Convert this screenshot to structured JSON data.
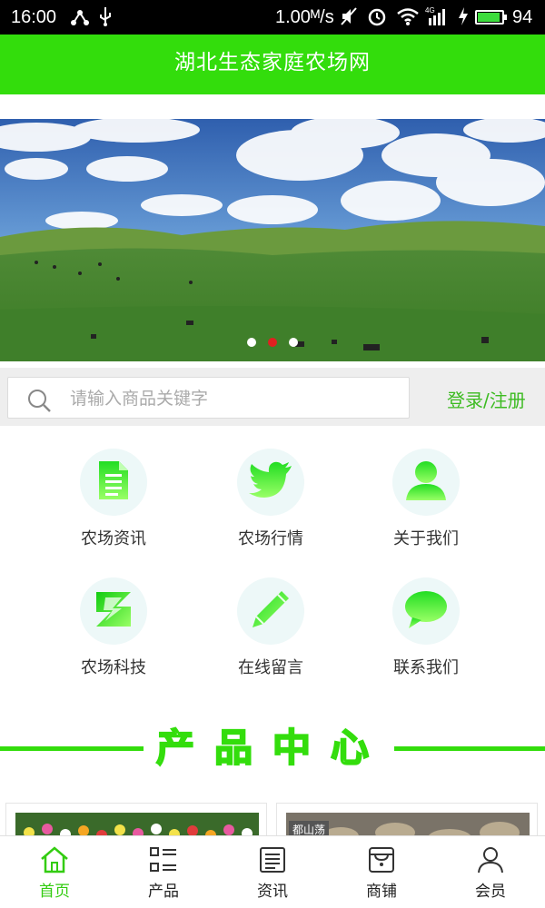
{
  "status_bar": {
    "time": "16:00",
    "speed": "1.00ᴹ/s",
    "battery": "94",
    "battery_level": 0.94,
    "network": "4G"
  },
  "header": {
    "title": "湖北生态家庭农场网"
  },
  "banner": {
    "slide_count": 3,
    "active_slide": 2
  },
  "search": {
    "placeholder": "请输入商品关键字",
    "login_label": "登录/注册"
  },
  "menu": {
    "items": [
      {
        "label": "农场资讯",
        "icon": "document-icon"
      },
      {
        "label": "农场行情",
        "icon": "bird-icon"
      },
      {
        "label": "关于我们",
        "icon": "person-icon"
      },
      {
        "label": "农场科技",
        "icon": "z-logo-icon"
      },
      {
        "label": "在线留言",
        "icon": "pencil-icon"
      },
      {
        "label": "联系我们",
        "icon": "chat-bubble-icon"
      }
    ]
  },
  "products": {
    "section_title": "产品中心",
    "second_card_tag": "都山荡"
  },
  "tabbar": {
    "tabs": [
      {
        "label": "首页",
        "icon": "home-icon",
        "active": true
      },
      {
        "label": "产品",
        "icon": "list-icon",
        "active": false
      },
      {
        "label": "资讯",
        "icon": "news-icon",
        "active": false
      },
      {
        "label": "商铺",
        "icon": "shop-icon",
        "active": false
      },
      {
        "label": "会员",
        "icon": "user-icon",
        "active": false
      }
    ]
  },
  "colors": {
    "accent": "#33dd0c",
    "link": "#3dbb22",
    "active_dot": "#e02020"
  }
}
